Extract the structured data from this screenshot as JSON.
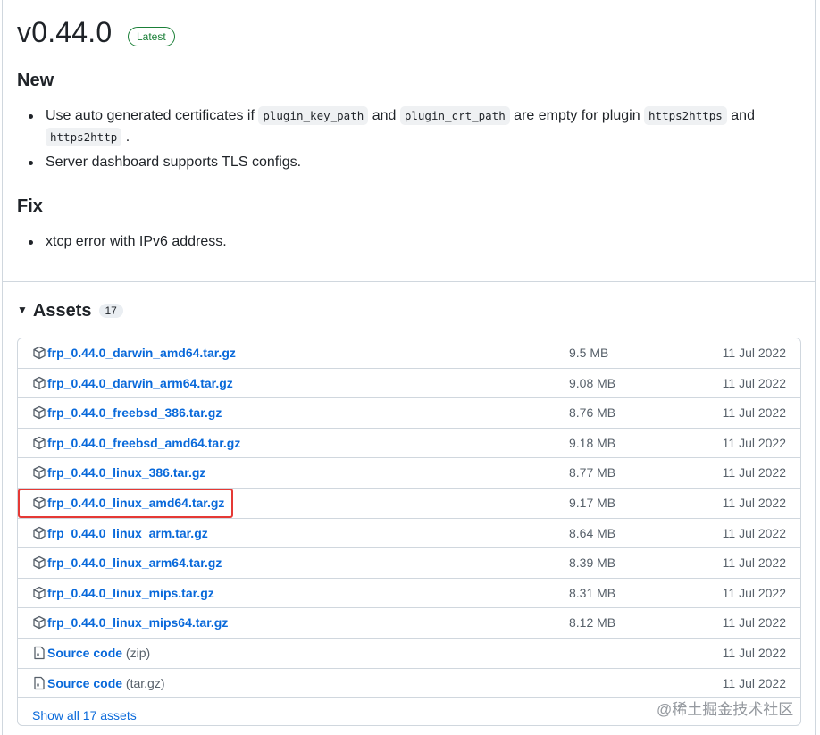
{
  "release": {
    "title": "v0.44.0",
    "badge": "Latest"
  },
  "sections": {
    "new_heading": "New",
    "new_item1": {
      "t1": "Use auto generated certificates if ",
      "c1": "plugin_key_path",
      "t2": " and ",
      "c2": "plugin_crt_path",
      "t3": " are empty for plugin ",
      "c3": "https2https",
      "t4": " and ",
      "c4": "https2http",
      "t5": " ."
    },
    "new_item2": "Server dashboard supports TLS configs.",
    "fix_heading": "Fix",
    "fix_item1": "xtcp error with IPv6 address."
  },
  "assets": {
    "heading": "Assets",
    "count": "17",
    "files": [
      {
        "name": "frp_0.44.0_darwin_amd64.tar.gz",
        "size": "9.5 MB",
        "date": "11 Jul 2022",
        "icon": "package-icon"
      },
      {
        "name": "frp_0.44.0_darwin_arm64.tar.gz",
        "size": "9.08 MB",
        "date": "11 Jul 2022",
        "icon": "package-icon"
      },
      {
        "name": "frp_0.44.0_freebsd_386.tar.gz",
        "size": "8.76 MB",
        "date": "11 Jul 2022",
        "icon": "package-icon"
      },
      {
        "name": "frp_0.44.0_freebsd_amd64.tar.gz",
        "size": "9.18 MB",
        "date": "11 Jul 2022",
        "icon": "package-icon"
      },
      {
        "name": "frp_0.44.0_linux_386.tar.gz",
        "size": "8.77 MB",
        "date": "11 Jul 2022",
        "icon": "package-icon"
      },
      {
        "name": "frp_0.44.0_linux_amd64.tar.gz",
        "size": "9.17 MB",
        "date": "11 Jul 2022",
        "icon": "package-icon",
        "highlighted": true
      },
      {
        "name": "frp_0.44.0_linux_arm.tar.gz",
        "size": "8.64 MB",
        "date": "11 Jul 2022",
        "icon": "package-icon"
      },
      {
        "name": "frp_0.44.0_linux_arm64.tar.gz",
        "size": "8.39 MB",
        "date": "11 Jul 2022",
        "icon": "package-icon"
      },
      {
        "name": "frp_0.44.0_linux_mips.tar.gz",
        "size": "8.31 MB",
        "date": "11 Jul 2022",
        "icon": "package-icon"
      },
      {
        "name": "frp_0.44.0_linux_mips64.tar.gz",
        "size": "8.12 MB",
        "date": "11 Jul 2022",
        "icon": "package-icon"
      }
    ],
    "source_zip": {
      "label": "Source code",
      "suffix": "(zip)",
      "date": "11 Jul 2022",
      "icon": "file-zip-icon"
    },
    "source_tar": {
      "label": "Source code",
      "suffix": "(tar.gz)",
      "date": "11 Jul 2022",
      "icon": "file-zip-icon"
    },
    "show_all": "Show all 17 assets"
  },
  "watermark": "@稀土掘金技术社区",
  "colors": {
    "link": "#0969da",
    "latest": "#1a7f37",
    "highlight": "#e53935"
  }
}
